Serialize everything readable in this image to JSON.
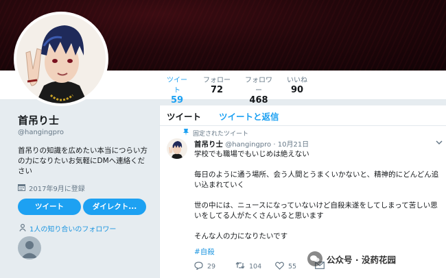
{
  "profile": {
    "name": "首吊り士",
    "handle": "@hangingpro",
    "bio": "首吊りの知識を広めたい本当につらい方の力になりたいお気軽にDMへ連絡ください",
    "joined": "2017年9月に登録",
    "tweet_button": "ツイート",
    "dm_button": "ダイレクト...",
    "followers_you_know": "1人の知り合いのフォロワー"
  },
  "stats": [
    {
      "label": "ツイート",
      "value": "59",
      "active": true
    },
    {
      "label": "フォロー",
      "value": "72"
    },
    {
      "label": "フォロワー",
      "value": "468"
    },
    {
      "label": "いいね",
      "value": "90"
    }
  ],
  "tabs": {
    "tweets": "ツイート",
    "tweets_replies": "ツイートと返信"
  },
  "tweet": {
    "pinned": "固定されたツイート",
    "name": "首吊り士",
    "handle": "@hangingpro",
    "sep": "·",
    "date": "10月21日",
    "lines": [
      "学校でも職場でもいじめは絶えない",
      "毎日のように通う場所、会う人間とうまくいかないと、精神的にどんどん追い込まれていく",
      "世の中には、ニュースになっていないけど自殺未遂をしてしまって苦しい思いをしてる人がたくさんいると思います",
      "そんな人の力になりたいです"
    ],
    "hashtag": "#自殺",
    "replies": "29",
    "retweets": "104",
    "likes": "55"
  },
  "watermark": {
    "text": "公众号 · 没药花园"
  },
  "colors": {
    "accent": "#1da1f2",
    "link": "#1b95e0",
    "muted": "#657786"
  }
}
